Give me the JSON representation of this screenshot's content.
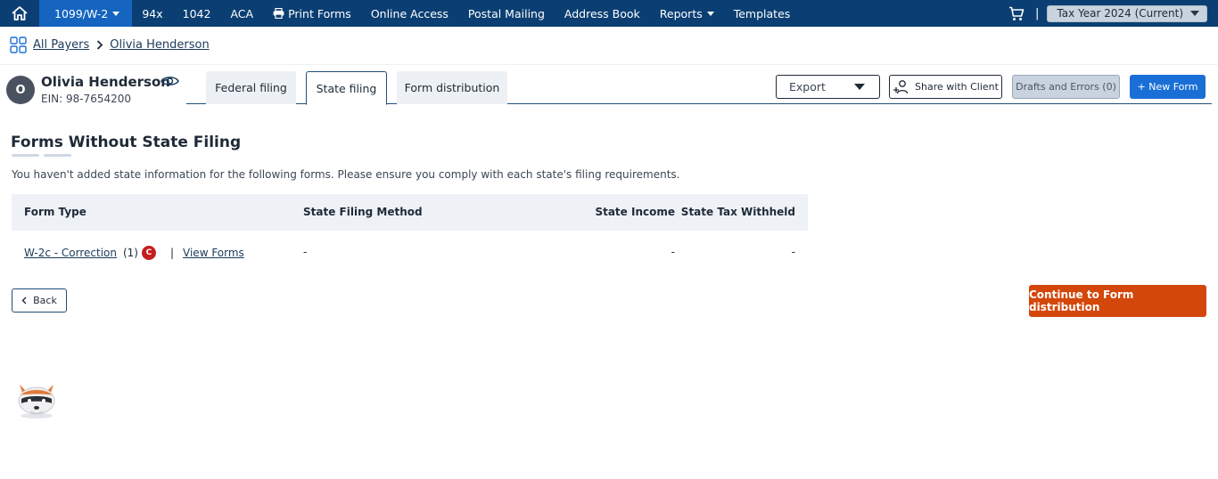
{
  "nav": {
    "home_icon": "home-icon",
    "items": [
      {
        "label": "1099/W-2",
        "active": true,
        "dropdown": true
      },
      {
        "label": "94x"
      },
      {
        "label": "1042"
      },
      {
        "label": "ACA"
      },
      {
        "label": "Print Forms",
        "icon": "printer-icon"
      },
      {
        "label": "Online Access"
      },
      {
        "label": "Postal Mailing"
      },
      {
        "label": "Address Book"
      },
      {
        "label": "Reports",
        "dropdown": true
      },
      {
        "label": "Templates"
      }
    ],
    "cart_icon": "cart-icon",
    "separator": "|",
    "tax_year": "Tax Year 2024 (Current)"
  },
  "breadcrumb": {
    "root": "All Payers",
    "current": "Olivia Henderson"
  },
  "payer": {
    "initial": "O",
    "name": "Olivia Henderson",
    "ein": "EIN: 98-7654200"
  },
  "tabs": [
    {
      "label": "Federal filing",
      "active": false
    },
    {
      "label": "State filing",
      "active": true
    },
    {
      "label": "Form distribution",
      "active": false
    }
  ],
  "actions": {
    "export": "Export",
    "share": "Share with Client",
    "drafts": "Drafts and Errors (0)",
    "new_form": "+ New Form"
  },
  "section": {
    "title": "Forms Without State Filing",
    "description": "You haven't added state information for the following forms. Please ensure you comply with each state's filing requirements."
  },
  "table": {
    "headers": [
      "Form Type",
      "State Filing Method",
      "State Income",
      "State Tax Withheld"
    ],
    "rows": [
      {
        "form_type": "W-2c - Correction",
        "count": "(1)",
        "badge": "C",
        "separator": "|",
        "view_link": "View Forms",
        "filing_method": "-",
        "state_income": "-",
        "state_tax_withheld": "-"
      }
    ]
  },
  "footer": {
    "back": "Back",
    "continue": "Continue to Form distribution"
  },
  "colors": {
    "nav_bg": "#0b3f73",
    "nav_active": "#1565c0",
    "primary_button": "#1a6fd6",
    "continue_button": "#d4470a",
    "badge": "#c41e1e"
  }
}
